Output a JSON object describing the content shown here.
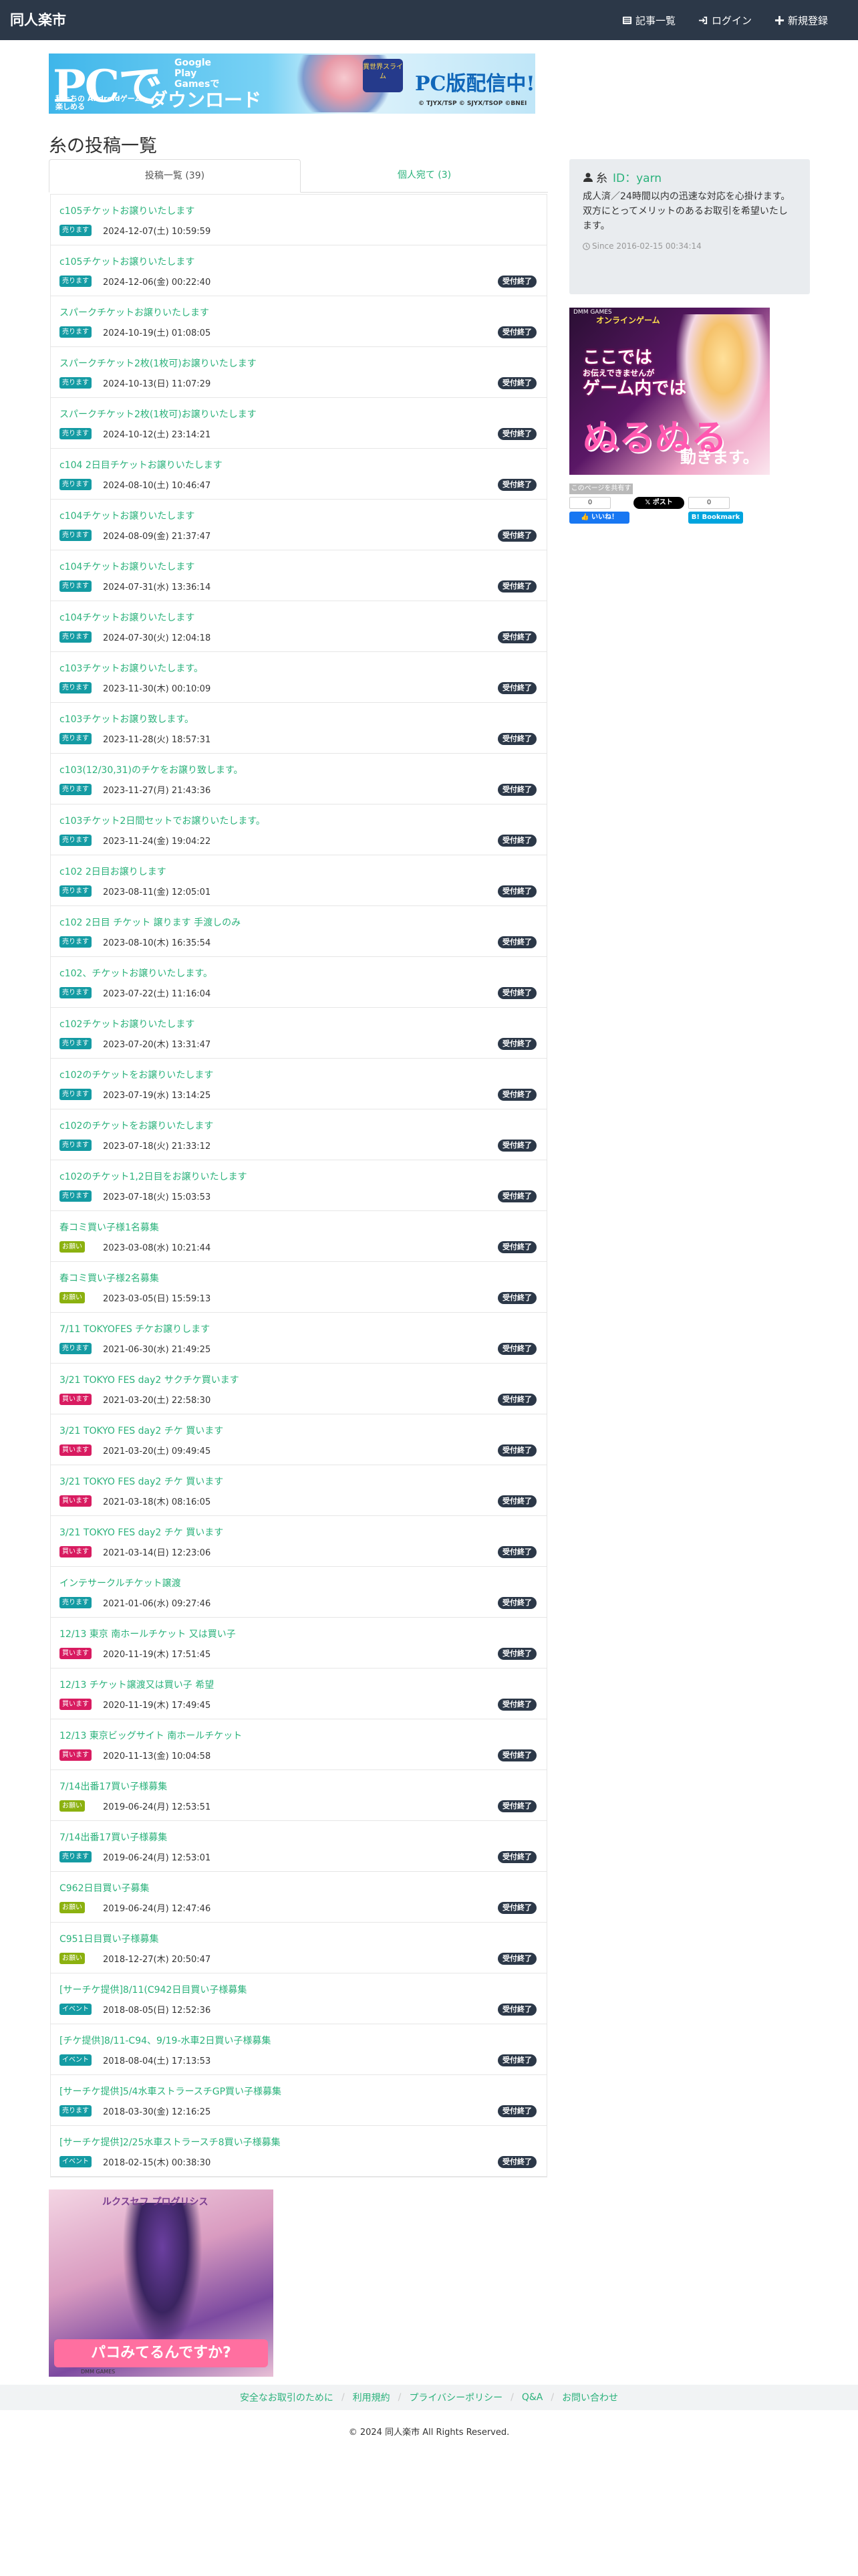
{
  "navbar": {
    "brand": "同人楽市",
    "links": [
      "記事一覧",
      "ログイン",
      "新規登録"
    ]
  },
  "banner_top": {
    "pc": "PCで",
    "gp_line1": "Google",
    "gp_line2": "Play",
    "gp_line3": "Gamesで",
    "dl": "ダウンロード",
    "sub1": "私たちの Androidゲーム",
    "sub2": "楽しめる",
    "pc_release": "PC版配信中!",
    "logo_text": "異世界スライム",
    "tiny": "© TJYX/TSP © SJYX/TSOP ©BNEI"
  },
  "page": {
    "title": "糸の投稿一覧",
    "tabs": [
      {
        "label": "投稿一覧 (39)",
        "active": true
      },
      {
        "label": "個人宛て (3)",
        "active": false
      }
    ]
  },
  "posts": [
    {
      "title": "c105チケットお譲りいたします",
      "badge": "売ります",
      "type": "sell",
      "date": "2024-12-07(土) 10:59:59",
      "status": ""
    },
    {
      "title": "c105チケットお譲りいたします",
      "badge": "売ります",
      "type": "sell",
      "date": "2024-12-06(金) 00:22:40",
      "status": "受付終了"
    },
    {
      "title": "スパークチケットお譲りいたします",
      "badge": "売ります",
      "type": "sell",
      "date": "2024-10-19(土) 01:08:05",
      "status": "受付終了"
    },
    {
      "title": "スパークチケット2枚(1枚可)お譲りいたします",
      "badge": "売ります",
      "type": "sell",
      "date": "2024-10-13(日) 11:07:29",
      "status": "受付終了"
    },
    {
      "title": "スパークチケット2枚(1枚可)お譲りいたします",
      "badge": "売ります",
      "type": "sell",
      "date": "2024-10-12(土) 23:14:21",
      "status": "受付終了"
    },
    {
      "title": "c104 2日目チケットお譲りいたします",
      "badge": "売ります",
      "type": "sell",
      "date": "2024-08-10(土) 10:46:47",
      "status": "受付終了"
    },
    {
      "title": "c104チケットお譲りいたします",
      "badge": "売ります",
      "type": "sell",
      "date": "2024-08-09(金) 21:37:47",
      "status": "受付終了"
    },
    {
      "title": "c104チケットお譲りいたします",
      "badge": "売ります",
      "type": "sell",
      "date": "2024-07-31(水) 13:36:14",
      "status": "受付終了"
    },
    {
      "title": "c104チケットお譲りいたします",
      "badge": "売ります",
      "type": "sell",
      "date": "2024-07-30(火) 12:04:18",
      "status": "受付終了"
    },
    {
      "title": "c103チケットお譲りいたします。",
      "badge": "売ります",
      "type": "sell",
      "date": "2023-11-30(木) 00:10:09",
      "status": "受付終了"
    },
    {
      "title": "c103チケットお譲り致します。",
      "badge": "売ります",
      "type": "sell",
      "date": "2023-11-28(火) 18:57:31",
      "status": "受付終了"
    },
    {
      "title": "c103(12/30,31)のチケをお譲り致します。",
      "badge": "売ります",
      "type": "sell",
      "date": "2023-11-27(月) 21:43:36",
      "status": "受付終了"
    },
    {
      "title": "c103チケット2日間セットでお譲りいたします。",
      "badge": "売ります",
      "type": "sell",
      "date": "2023-11-24(金) 19:04:22",
      "status": "受付終了"
    },
    {
      "title": "c102 2日目お譲りします",
      "badge": "売ります",
      "type": "sell",
      "date": "2023-08-11(金) 12:05:01",
      "status": "受付終了"
    },
    {
      "title": "c102 2日目 チケット 譲ります 手渡しのみ",
      "badge": "売ります",
      "type": "sell",
      "date": "2023-08-10(木) 16:35:54",
      "status": "受付終了"
    },
    {
      "title": "c102、チケットお譲りいたします。",
      "badge": "売ります",
      "type": "sell",
      "date": "2023-07-22(土) 11:16:04",
      "status": "受付終了"
    },
    {
      "title": "c102チケットお譲りいたします",
      "badge": "売ります",
      "type": "sell",
      "date": "2023-07-20(木) 13:31:47",
      "status": "受付終了"
    },
    {
      "title": "c102のチケットをお譲りいたします",
      "badge": "売ります",
      "type": "sell",
      "date": "2023-07-19(水) 13:14:25",
      "status": "受付終了"
    },
    {
      "title": "c102のチケットをお譲りいたします",
      "badge": "売ります",
      "type": "sell",
      "date": "2023-07-18(火) 21:33:12",
      "status": "受付終了"
    },
    {
      "title": "c102のチケット1,2日目をお譲りいたします",
      "badge": "売ります",
      "type": "sell",
      "date": "2023-07-18(火) 15:03:53",
      "status": "受付終了"
    },
    {
      "title": "春コミ買い子様1名募集",
      "badge": "お願い",
      "type": "wish",
      "date": "2023-03-08(水) 10:21:44",
      "status": "受付終了"
    },
    {
      "title": "春コミ買い子様2名募集",
      "badge": "お願い",
      "type": "wish",
      "date": "2023-03-05(日) 15:59:13",
      "status": "受付終了"
    },
    {
      "title": "7/11 TOKYOFES チケお譲りします",
      "badge": "売ります",
      "type": "sell",
      "date": "2021-06-30(水) 21:49:25",
      "status": "受付終了"
    },
    {
      "title": "3/21 TOKYO FES day2 サクチケ買います",
      "badge": "買います",
      "type": "buy",
      "date": "2021-03-20(土) 22:58:30",
      "status": "受付終了"
    },
    {
      "title": "3/21 TOKYO FES day2 チケ 買います",
      "badge": "買います",
      "type": "buy",
      "date": "2021-03-20(土) 09:49:45",
      "status": "受付終了"
    },
    {
      "title": "3/21 TOKYO FES day2 チケ 買います",
      "badge": "買います",
      "type": "buy",
      "date": "2021-03-18(木) 08:16:05",
      "status": "受付終了"
    },
    {
      "title": "3/21 TOKYO FES day2 チケ 買います",
      "badge": "買います",
      "type": "buy",
      "date": "2021-03-14(日) 12:23:06",
      "status": "受付終了"
    },
    {
      "title": "インテサークルチケット譲渡",
      "badge": "売ります",
      "type": "sell",
      "date": "2021-01-06(水) 09:27:46",
      "status": "受付終了"
    },
    {
      "title": "12/13 東京 南ホールチケット 又は買い子",
      "badge": "買います",
      "type": "buy",
      "date": "2020-11-19(木) 17:51:45",
      "status": "受付終了"
    },
    {
      "title": "12/13 チケット譲渡又は買い子 希望",
      "badge": "買います",
      "type": "buy",
      "date": "2020-11-19(木) 17:49:45",
      "status": "受付終了"
    },
    {
      "title": "12/13 東京ビッグサイト 南ホールチケット",
      "badge": "買います",
      "type": "buy",
      "date": "2020-11-13(金) 10:04:58",
      "status": "受付終了"
    },
    {
      "title": "7/14出番17買い子様募集",
      "badge": "お願い",
      "type": "wish",
      "date": "2019-06-24(月) 12:53:51",
      "status": "受付終了"
    },
    {
      "title": "7/14出番17買い子様募集",
      "badge": "売ります",
      "type": "sell",
      "date": "2019-06-24(月) 12:53:01",
      "status": "受付終了"
    },
    {
      "title": "C962日目買い子募集",
      "badge": "お願い",
      "type": "wish",
      "date": "2019-06-24(月) 12:47:46",
      "status": "受付終了"
    },
    {
      "title": "C951日目買い子様募集",
      "badge": "お願い",
      "type": "wish",
      "date": "2018-12-27(木) 20:50:47",
      "status": "受付終了"
    },
    {
      "title": "[サーチケ提供]8/11(C942日目買い子様募集",
      "badge": "イベント",
      "type": "event",
      "date": "2018-08-05(日) 12:52:36",
      "status": "受付終了"
    },
    {
      "title": "[チケ提供]8/11-C94、9/19-水車2日買い子様募集",
      "badge": "イベント",
      "type": "event",
      "date": "2018-08-04(土) 17:13:53",
      "status": "受付終了"
    },
    {
      "title": "[サーチケ提供]5/4水車ストラースチGP買い子様募集",
      "badge": "売ります",
      "type": "sell",
      "date": "2018-03-30(金) 12:16:25",
      "status": "受付終了"
    },
    {
      "title": "[サーチケ提供]2/25水車ストラースチ8買い子様募集",
      "badge": "イベント",
      "type": "event",
      "date": "2018-02-15(木) 00:38:30",
      "status": "受付終了"
    }
  ],
  "banner_bottom": {
    "title": "ルクスセフ プログリシス",
    "cta": "パコみてるんですか?",
    "foot": "DMM GAMES"
  },
  "sidebar": {
    "user_name": "糸",
    "user_id": "ID：yarn",
    "bio": "成人済／24時間以内の迅速な対応を心掛けます。双方にとってメリットのあるお取引を希望いたします。",
    "since": "Since 2016-02-15 00:34:14"
  },
  "ad_side": {
    "brand": "DMM GAMES",
    "header": "オンラインゲーム",
    "line1": "ここでは",
    "line1b": "お伝えできませんが",
    "line2": "ゲーム内では",
    "big": "ぬるぬる",
    "end": "動きます。"
  },
  "share": {
    "label": "このページを共有する",
    "fb_count": "0",
    "hb_count": "0",
    "fb": "いいね！",
    "x": "ポスト",
    "hb": "Bookmark"
  },
  "footer": {
    "links": [
      "安全なお取引のために",
      "利用規約",
      "プライバシーポリシー",
      "Q&A",
      "お問い合わせ"
    ],
    "copyright": "© 2024 同人楽市 All Rights Reserved."
  }
}
